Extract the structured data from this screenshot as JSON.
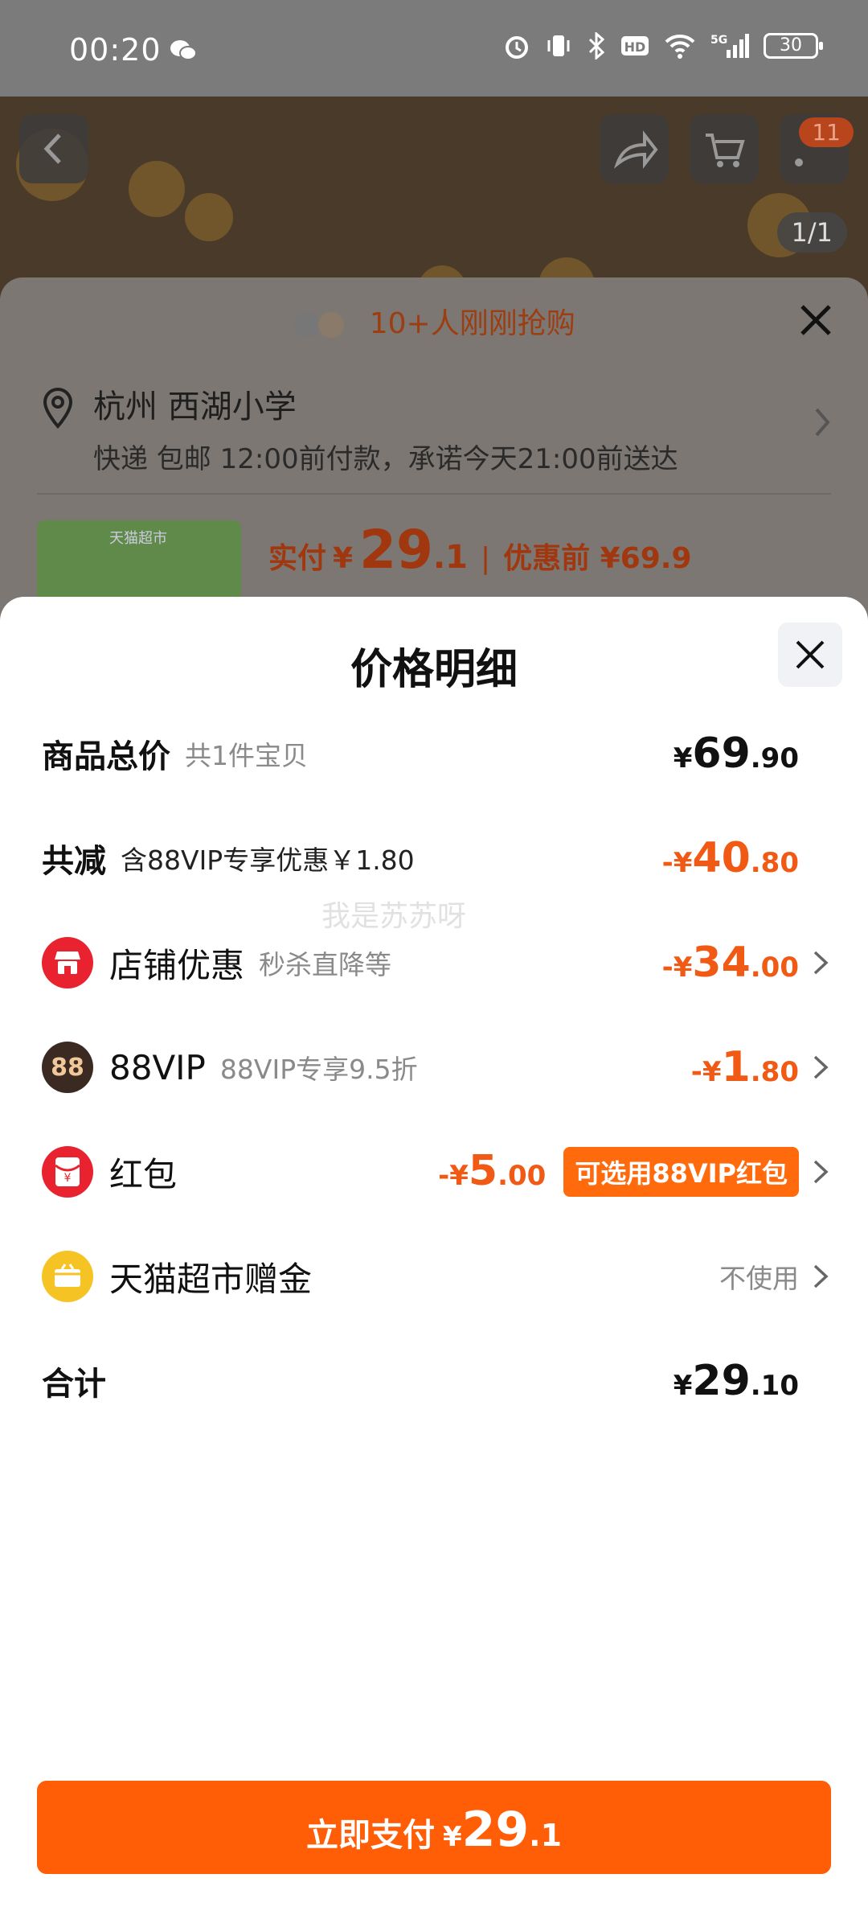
{
  "status_bar": {
    "time": "00:20",
    "battery": "30",
    "icons": [
      "wechat-icon",
      "alarm-icon",
      "vibrate-icon",
      "bluetooth-icon",
      "hd-icon",
      "wifi-icon",
      "signal-5g-icon",
      "battery-icon"
    ]
  },
  "product_page": {
    "cart_badge": "11",
    "image_counter": "1/1"
  },
  "order_sheet": {
    "buyers_text": "10+人刚刚抢购",
    "address_title": "杭州 西湖小学",
    "delivery_text": "快递 包邮 12:00前付款，承诺今天21:00前送达",
    "thumb_label": "天猫超市",
    "actual_label": "实付",
    "actual_symbol": "¥",
    "actual_int": "29",
    "actual_dec": ".1",
    "before_text": "优惠前 ¥69.9"
  },
  "price_detail": {
    "title": "价格明细",
    "rows": {
      "total_goods": {
        "label": "商品总价",
        "sub": "共1件宝贝",
        "y": "¥",
        "int": "69",
        "dec": ".90"
      },
      "total_discount": {
        "label": "共减",
        "sub": "含88VIP专享优惠￥1.80",
        "y": "-¥",
        "int": "40",
        "dec": ".80"
      },
      "shop_discount": {
        "label": "店铺优惠",
        "sub": "秒杀直降等",
        "y": "-¥",
        "int": "34",
        "dec": ".00"
      },
      "vip": {
        "label": "88VIP",
        "sub": "88VIP专享9.5折",
        "y": "-¥",
        "int": "1",
        "dec": ".80",
        "icon_text": "88"
      },
      "red_packet": {
        "label": "红包",
        "y": "-¥",
        "int": "5",
        "dec": ".00",
        "tag": "可选用88VIP红包",
        "icon_text": "¥"
      },
      "gift_money": {
        "label": "天猫超市赠金",
        "value": "不使用"
      },
      "total": {
        "label": "合计",
        "y": "¥",
        "int": "29",
        "dec": ".10"
      }
    },
    "watermark": "我是苏苏呀"
  },
  "pay_button": {
    "label": "立即支付",
    "y": "¥",
    "int": "29",
    "dec": ".1"
  },
  "colors": {
    "accent": "#FF5E06",
    "discount": "#F05A14",
    "shop_icon": "#E8232F",
    "vip_icon": "#3A2A22",
    "gift_icon": "#F5C323"
  }
}
